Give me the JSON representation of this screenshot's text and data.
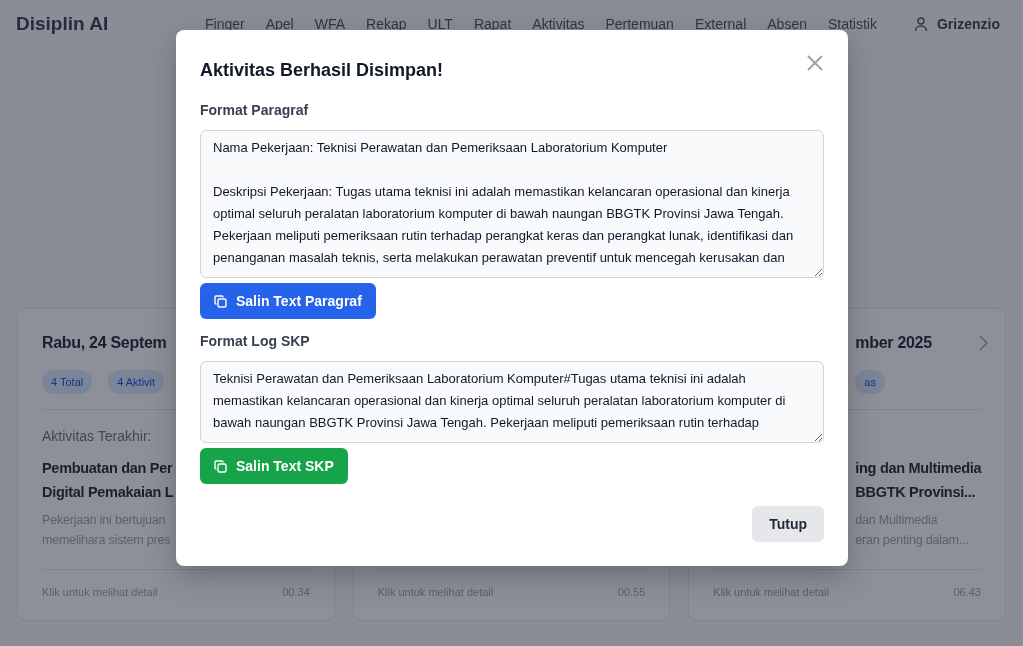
{
  "navbar": {
    "brand": "Disiplin AI",
    "links": [
      "Finger",
      "Apel",
      "WFA",
      "Rekap",
      "ULT",
      "Rapat",
      "Aktivitas",
      "Pertemuan",
      "External",
      "Absen",
      "Statistik"
    ],
    "user": "Grizenzio"
  },
  "cards": [
    {
      "title": "Rabu, 24 Septem",
      "chevron": false,
      "badges": [
        "4 Total",
        "4 Aktivit"
      ],
      "recent_label": "Aktivitas Terakhir:",
      "activity_title": [
        "Pembuatan dan Per",
        "Digital Pemakaian L"
      ],
      "activity_desc": [
        "Pekerjaan ini bertujuan",
        "memelihara sistem pres"
      ],
      "footer": "Klik untuk melihat detail",
      "time": "00.34"
    },
    {
      "chevron": false,
      "footer": "Klik untuk melihat detail",
      "time": "00.55"
    },
    {
      "title": "mber 2025",
      "chevron": true,
      "badges": [
        "as"
      ],
      "activity_title": [
        "ing dan Multimedia",
        "BBGTK Provinsi..."
      ],
      "activity_desc": [
        "dan Multimedia",
        "eran penting dalam..."
      ],
      "footer": "Klik untuk melihat detail",
      "time": "06.43"
    }
  ],
  "modal": {
    "title": "Aktivitas Berhasil Disimpan!",
    "sections": [
      {
        "label": "Format Paragraf",
        "value": "Nama Pekerjaan: Teknisi Perawatan dan Pemeriksaan Laboratorium Komputer\n\nDeskripsi Pekerjaan: Tugas utama teknisi ini adalah memastikan kelancaran operasional dan kinerja optimal seluruh peralatan laboratorium komputer di bawah naungan BBGTK Provinsi Jawa Tengah. Pekerjaan meliputi pemeriksaan rutin terhadap perangkat keras dan perangkat lunak, identifikasi dan penanganan masalah teknis, serta melakukan perawatan preventif untuk mencegah kerusakan dan",
        "button": "Salin Text Paragraf"
      },
      {
        "label": "Format Log SKP",
        "value": "Teknisi Perawatan dan Pemeriksaan Laboratorium Komputer#Tugas utama teknisi ini adalah memastikan kelancaran operasional dan kinerja optimal seluruh peralatan laboratorium komputer di bawah naungan BBGTK Provinsi Jawa Tengah. Pekerjaan meliputi pemeriksaan rutin terhadap",
        "button": "Salin Text SKP"
      }
    ],
    "close_button": "Tutup"
  }
}
